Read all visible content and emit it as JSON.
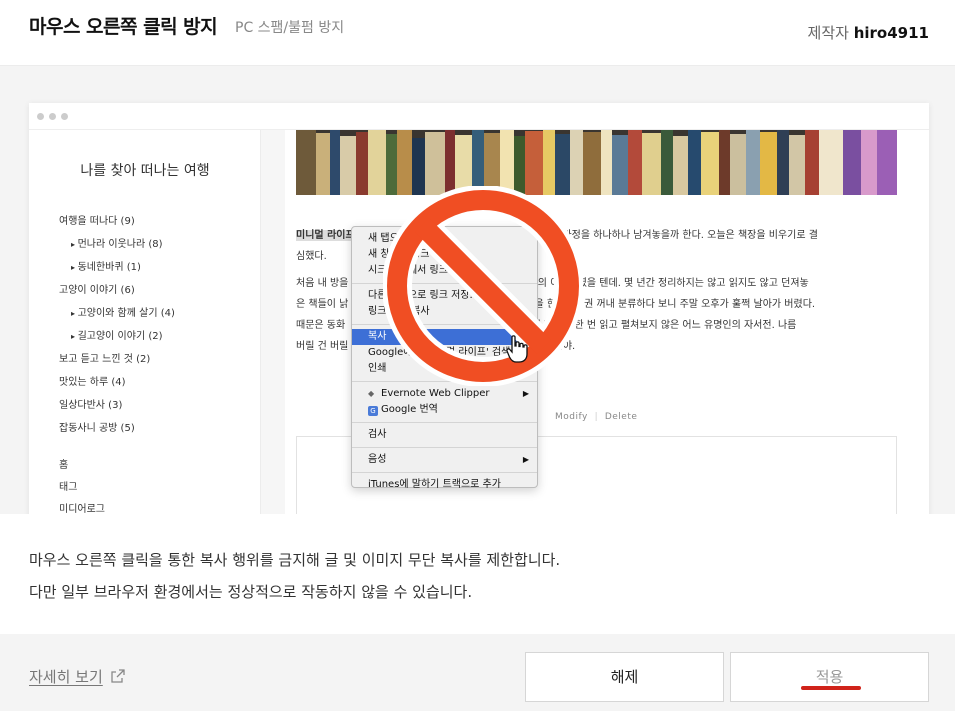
{
  "header": {
    "title": "마우스 오른쪽 클릭 방지",
    "subtitle": "PC 스팸/불펌 방지",
    "author_label": "제작자",
    "author_name": "hiro4911"
  },
  "preview": {
    "blog_title": "나를 찾아 떠나는 여행",
    "categories": [
      "여행을 떠나다 (9)",
      "먼나라 이웃나라 (8)",
      "동네한바퀴 (1)",
      "고양이 이야기 (6)",
      "고양이와 함께 살기 (4)",
      "길고양이 이야기 (2)",
      "보고 듣고 느낀 것 (2)",
      "맛있는 하루 (4)",
      "일상다반사 (3)",
      "잡동사니 공방 (5)"
    ],
    "menu": [
      "홈",
      "태그",
      "미디어로그"
    ],
    "post": {
      "highlight": "미니멀 라이프",
      "line1_rest": "                                              고자 청소하는 과정을 하나하나 남겨놓을까 한다. 오늘은 책장을 비우기로 결",
      "line2": "심했다.",
      "line3": "처음 내 방을                                          인 오     서재의 이미지였을 텐데. 몇 년간 정리하지는 않고 읽지도 않고 던져놓",
      "line4": "은 책들이 낡                                        는 기     로 책을 한 권 두 권 꺼내 분류하다 보니 주말 오후가 훌쩍 날아가 버렸다.",
      "line5": "때문은 동화                                         진     후감 숙제 때문에 한 번 읽고 펼쳐보지 않은 어느 유명인의 자서전. 나름",
      "line6": "버릴 건 버릴                                                   나 많을 줄이야."
    },
    "actions": [
      "Modify",
      "Delete"
    ],
    "context_menu": [
      {
        "label": "새 탭으로 링크 열기"
      },
      {
        "label": "새 창으로 링크 열기"
      },
      {
        "label": "시크릿 창에서 링크 열기"
      },
      {
        "label": "다른 이름으로 링크 저장..."
      },
      {
        "label": "링크 주소 복사"
      },
      {
        "label": "복사"
      },
      {
        "label": "Google에서 '미니멀 라이프' 검색"
      },
      {
        "label": "인쇄"
      },
      {
        "label": "Evernote Web Clipper"
      },
      {
        "label": "Google 번역"
      },
      {
        "label": "검사"
      },
      {
        "label": "음성"
      },
      {
        "label": "iTunes에 말하기 트랙으로 추가"
      }
    ],
    "ban_color": "#f04e23"
  },
  "description": {
    "line1": "마우스 오른쪽 클릭을 통한 복사 행위를 금지해 글 및 이미지 무단 복사를 제한합니다.",
    "line2": "다만 일부 브라우저 환경에서는 정상적으로 작동하지 않을 수 있습니다."
  },
  "footer": {
    "more_link": "자세히 보기",
    "release_button": "해제",
    "apply_button": "적용",
    "accent_color": "#d0231a"
  }
}
